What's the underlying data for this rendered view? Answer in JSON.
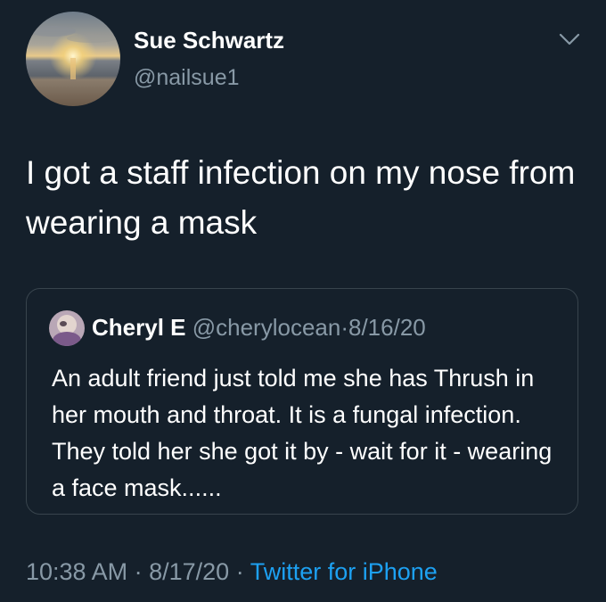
{
  "author": {
    "name": "Sue Schwartz",
    "handle": "@nailsue1"
  },
  "tweet": {
    "text": "I got a staff infection on my nose from wearing a mask"
  },
  "quoted_tweet": {
    "name": "Cheryl E",
    "handle": "@cherylocean",
    "separator": "·",
    "date": "8/16/20",
    "text": "An adult friend just told me she has Thrush in her mouth and throat.  It is a fungal infection.  They told her she got it by - wait for it - wearing a face mask......"
  },
  "meta": {
    "time": "10:38 AM",
    "separator": "·",
    "date": "8/17/20",
    "separator2": "·",
    "source": "Twitter for iPhone"
  },
  "colors": {
    "background": "#15202b",
    "secondary_text": "#8899a6",
    "link": "#1da1f2",
    "border": "#38444d"
  },
  "icons": {
    "menu": "chevron-down-icon"
  }
}
